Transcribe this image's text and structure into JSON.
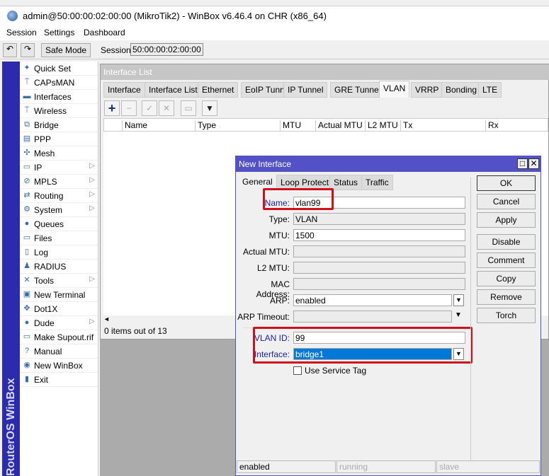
{
  "window": {
    "title": "admin@50:00:00:02:00:00 (MikroTik2) - WinBox v6.46.4 on CHR (x86_64)"
  },
  "menu": [
    "Session",
    "Settings",
    "Dashboard"
  ],
  "toolbar": {
    "undo": "↶",
    "redo": "↷",
    "safe_mode": "Safe Mode",
    "session_label": "Session:",
    "session_value": "50:00:00:02:00:00"
  },
  "brand": "RouterOS WinBox",
  "sidebar": [
    {
      "label": "Quick Set",
      "icon": "quick-set-icon",
      "g": "✦"
    },
    {
      "label": "CAPsMAN",
      "icon": "antenna-icon",
      "g": "⍑"
    },
    {
      "label": "Interfaces",
      "icon": "interfaces-icon",
      "g": "▬"
    },
    {
      "label": "Wireless",
      "icon": "wireless-icon",
      "g": "⍑"
    },
    {
      "label": "Bridge",
      "icon": "bridge-icon",
      "g": "⧉"
    },
    {
      "label": "PPP",
      "icon": "ppp-icon",
      "g": "▤"
    },
    {
      "label": "Mesh",
      "icon": "mesh-icon",
      "g": "✣"
    },
    {
      "label": "IP",
      "icon": "ip-icon",
      "g": "▭",
      "sub": true
    },
    {
      "label": "MPLS",
      "icon": "mpls-icon",
      "g": "⊘",
      "sub": true
    },
    {
      "label": "Routing",
      "icon": "routing-icon",
      "g": "⇄",
      "sub": true
    },
    {
      "label": "System",
      "icon": "system-icon",
      "g": "⚙",
      "sub": true
    },
    {
      "label": "Queues",
      "icon": "queues-icon",
      "g": "●"
    },
    {
      "label": "Files",
      "icon": "files-icon",
      "g": "▭"
    },
    {
      "label": "Log",
      "icon": "log-icon",
      "g": "▯"
    },
    {
      "label": "RADIUS",
      "icon": "radius-icon",
      "g": "♟"
    },
    {
      "label": "Tools",
      "icon": "tools-icon",
      "g": "✕",
      "sub": true
    },
    {
      "label": "New Terminal",
      "icon": "terminal-icon",
      "g": "▣"
    },
    {
      "label": "Dot1X",
      "icon": "dot1x-icon",
      "g": "✥"
    },
    {
      "label": "Dude",
      "icon": "dude-icon",
      "g": "●",
      "sub": true
    },
    {
      "label": "Make Supout.rif",
      "icon": "supout-icon",
      "g": "▭"
    },
    {
      "label": "Manual",
      "icon": "manual-icon",
      "g": "?"
    },
    {
      "label": "New WinBox",
      "icon": "winbox-icon",
      "g": "◉"
    },
    {
      "label": "Exit",
      "icon": "exit-icon",
      "g": "▮"
    }
  ],
  "interface_list": {
    "title": "Interface List",
    "tabs": [
      "Interface",
      "Interface List",
      "Ethernet",
      "EoIP Tunnel",
      "IP Tunnel",
      "GRE Tunnel",
      "VLAN",
      "VRRP",
      "Bonding",
      "LTE"
    ],
    "active_tab": "VLAN",
    "columns": [
      "Name",
      "Type",
      "MTU",
      "Actual MTU",
      "L2 MTU",
      "Tx",
      "Rx"
    ],
    "status": "0 items out of 13"
  },
  "dialog": {
    "title": "New Interface",
    "tabs": [
      "General",
      "Loop Protect",
      "Status",
      "Traffic"
    ],
    "fields": {
      "name": {
        "label": "Name:",
        "value": "vlan99"
      },
      "type": {
        "label": "Type:",
        "value": "VLAN"
      },
      "mtu": {
        "label": "MTU:",
        "value": "1500"
      },
      "actual_mtu": {
        "label": "Actual MTU:",
        "value": ""
      },
      "l2_mtu": {
        "label": "L2 MTU:",
        "value": ""
      },
      "mac": {
        "label": "MAC Address:",
        "value": ""
      },
      "arp": {
        "label": "ARP:",
        "value": "enabled"
      },
      "arp_timeout": {
        "label": "ARP Timeout:",
        "value": ""
      },
      "vlan_id": {
        "label": "VLAN ID:",
        "value": "99"
      },
      "interface": {
        "label": "Interface:",
        "value": "bridge1"
      },
      "service_tag": {
        "label": "Use Service Tag",
        "checked": false
      }
    },
    "buttons": [
      "OK",
      "Cancel",
      "Apply",
      "Disable",
      "Comment",
      "Copy",
      "Remove",
      "Torch"
    ],
    "status": [
      "enabled",
      "running",
      "slave"
    ],
    "highlight_color": "#d0101a",
    "title_color": "#5252c6"
  }
}
